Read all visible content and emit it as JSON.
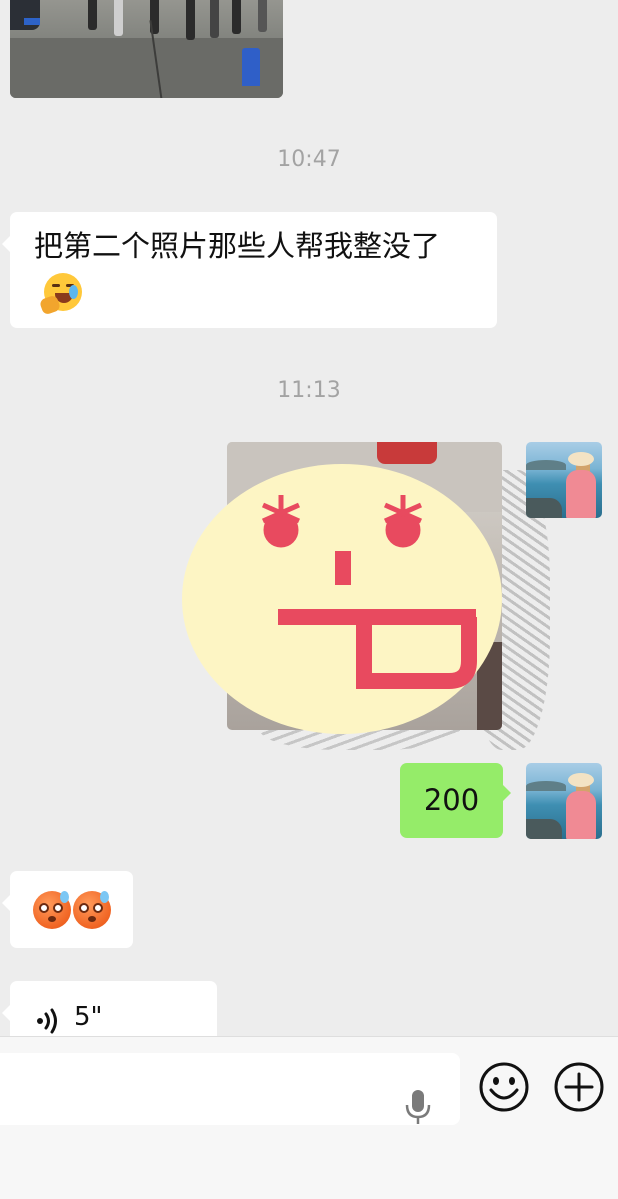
{
  "messages": {
    "time_1": "10:47",
    "text_1": "把第二个照片那些人帮我整没了",
    "time_2": "11:13",
    "sent_amount": "200",
    "voice_duration": "5\""
  },
  "icons": {
    "laugh_emoji": "rolling-on-floor-laughing",
    "shock_emoji": "flushed-face",
    "voice": "voice-wave-icon",
    "mic": "microphone-icon",
    "emoji_button": "smiley-icon",
    "plus_button": "plus-circle-icon"
  },
  "colors": {
    "background": "#ededed",
    "sent_bubble": "#95ec69",
    "received_bubble": "#ffffff",
    "timestamp": "#a3a3a3",
    "sticker_face": "#fdf5c4",
    "sticker_features": "#e84a5f"
  }
}
